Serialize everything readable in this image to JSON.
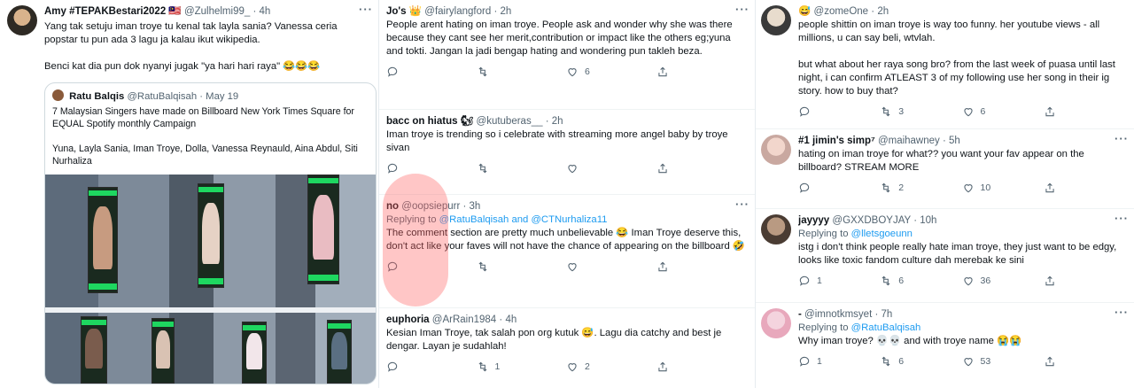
{
  "col1": {
    "tweet": {
      "name": "Amy #TEPAKBestari2022 🇲🇾",
      "handle": "@Zulhelmi99_",
      "time": "4h",
      "text": "Yang tak setuju iman troye tu kenal tak layla sania? Vanessa ceria popstar tu pun ada 3 lagu ja kalau ikut wikipedia.\n\nBenci kat dia pun dok nyanyi jugak \"ya hari hari raya\" 😂😂😂",
      "quote": {
        "name": "Ratu Balqis",
        "handle": "@RatuBalqisah",
        "date": "May 19",
        "text": "7 Malaysian Singers have made on Billboard New York Times Square for EQUAL Spotify monthly Campaign\n\nYuna, Layla Sania, Iman Troye, Dolla, Vanessa Reynauld, Aina Abdul, Siti Nurhaliza"
      }
    }
  },
  "col2": [
    {
      "name": "Jo's 👑",
      "handle": "@fairylangford",
      "time": "2h",
      "text": "People arent hating on iman troye. People ask and wonder why she was there because they cant see her merit,contribution or impact like the others eg;yuna and tokti. Jangan la jadi bengap hating and wondering pun takleh beza.",
      "replies": "",
      "retweets": "",
      "likes": "6"
    },
    {
      "name": "bacc on hiatus 🐿",
      "handle": "@kutuberas__",
      "time": "2h",
      "text": "Iman troye is trending so i celebrate with streaming more angel baby by troye sivan",
      "replies": "",
      "retweets": "",
      "likes": ""
    },
    {
      "name": "no",
      "handle": "@oopsiepurr",
      "time": "3h",
      "replying_prefix": "Replying to",
      "replying_to": "@RatuBalqisah and @CTNurhaliza11",
      "text": "The comment section are pretty much unbelievable 😂 Iman Troye deserve this, don't act like your faves will not have the chance of appearing on the billboard 🤣",
      "replies": "",
      "retweets": "",
      "likes": ""
    },
    {
      "name": "euphoria",
      "handle": "@ArRain1984",
      "time": "4h",
      "text": "Kesian Iman Troye, tak salah pon org kutuk 😅. Lagu dia catchy and best je dengar. Layan je sudahlah!",
      "replies": "",
      "retweets": "1",
      "likes": "2"
    }
  ],
  "col3": [
    {
      "name": "😅",
      "handle": "@zomeOne",
      "time": "2h",
      "text": "people shittin on iman troye is way too funny. her youtube views - all millions, u can say beli, wtvlah.\n\nbut what about her raya song bro? from the last week of puasa until last night, i can confirm ATLEAST 3 of my following use her song in their ig story. how to buy that?",
      "replies": "",
      "retweets": "3",
      "likes": "6"
    },
    {
      "name": "#1 jimin's simp⁷",
      "handle": "@maihawney",
      "time": "5h",
      "text": "hating on iman troye for what?? you want your fav appear on the billboard? STREAM MORE",
      "replies": "",
      "retweets": "2",
      "likes": "10"
    },
    {
      "name": "jayyyy",
      "handle": "@GXXDBOYJAY",
      "time": "10h",
      "replying_prefix": "Replying to",
      "replying_to": "@lletsgoeunn",
      "text": "istg i don't think people really hate iman troye, they just want to be edgy, looks like toxic fandom culture dah merebak ke sini",
      "replies": "1",
      "retweets": "6",
      "likes": "36"
    },
    {
      "name": "-",
      "handle": "@imnotkmsyet",
      "time": "7h",
      "replying_prefix": "Replying to",
      "replying_to": "@RatuBalqisah",
      "text": "Why iman troye? 💀💀 and with troye name 😭😭",
      "replies": "1",
      "retweets": "6",
      "likes": "53"
    }
  ],
  "colors": {
    "accent": "#1d9bf0",
    "muted": "#536471",
    "spotify_green": "#1ed760"
  },
  "icons": [
    "reply-icon",
    "retweet-icon",
    "like-icon",
    "share-icon",
    "more-icon"
  ]
}
